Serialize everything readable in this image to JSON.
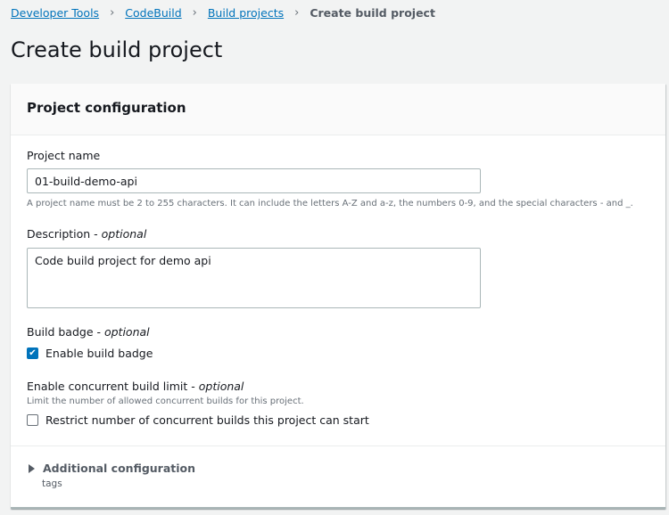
{
  "breadcrumb": {
    "items": [
      "Developer Tools",
      "CodeBuild",
      "Build projects"
    ],
    "current": "Create build project"
  },
  "page_title": "Create build project",
  "panel": {
    "title": "Project configuration",
    "project_name": {
      "label": "Project name",
      "value": "01-build-demo-api",
      "hint": "A project name must be 2 to 255 characters. It can include the letters A-Z and a-z, the numbers 0-9, and the special characters - and _."
    },
    "description": {
      "label": "Description - ",
      "optional": "optional",
      "value": "Code build project for demo api"
    },
    "build_badge": {
      "label": "Build badge - ",
      "optional": "optional",
      "checkbox_label": "Enable build badge",
      "checked": true
    },
    "concurrent": {
      "label": "Enable concurrent build limit - ",
      "optional": "optional",
      "hint": "Limit the number of allowed concurrent builds for this project.",
      "checkbox_label": "Restrict number of concurrent builds this project can start",
      "checked": false
    },
    "additional": {
      "label": "Additional configuration",
      "sub": "tags"
    }
  }
}
